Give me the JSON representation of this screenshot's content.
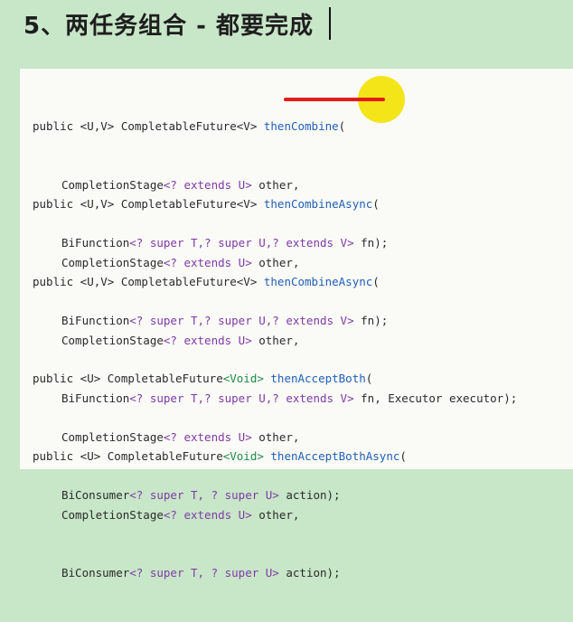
{
  "slide": {
    "title": "5、两任务组合 - 都要完成"
  },
  "blocks": [
    {
      "signature_prefix": "public <U,V> CompletableFuture<V> ",
      "method": "thenCombine",
      "signature_suffix": "(",
      "line2_prefix": "CompletionStage",
      "line2_generic": "<? extends U>",
      "line2_suffix": " other,",
      "line3_prefix": "BiFunction",
      "line3_generic": "<? super T,? super U,? extends V>",
      "line3_suffix": " fn);"
    },
    {
      "signature_prefix": "public <U,V> CompletableFuture<V> ",
      "method": "thenCombineAsync",
      "signature_suffix": "(",
      "line2_prefix": "CompletionStage",
      "line2_generic": "<? extends U>",
      "line2_suffix": " other,",
      "line3_prefix": "BiFunction",
      "line3_generic": "<? super T,? super U,? extends V>",
      "line3_suffix": " fn);"
    },
    {
      "signature_prefix": "public <U,V> CompletableFuture<V> ",
      "method": "thenCombineAsync",
      "signature_suffix": "(",
      "line2_prefix": "CompletionStage",
      "line2_generic": "<? extends U>",
      "line2_suffix": " other,",
      "line3_prefix": "BiFunction",
      "line3_generic": "<? super T,? super U,? extends V>",
      "line3_suffix": " fn, Executor executor);"
    },
    {
      "signature_prefix": "public <U> CompletableFuture",
      "generic_void": "<Void>",
      "method": " thenAcceptBoth",
      "signature_suffix": "(",
      "line2_prefix": "CompletionStage",
      "line2_generic": "<? extends U>",
      "line2_suffix": " other,",
      "line3_prefix": "BiConsumer",
      "line3_generic": "<? super T, ? super U>",
      "line3_suffix": " action);"
    },
    {
      "signature_prefix": "public <U> CompletableFuture",
      "generic_void": "<Void>",
      "method": " thenAcceptBothAsync",
      "signature_suffix": "(",
      "line2_prefix": "CompletionStage",
      "line2_generic": "<? extends U>",
      "line2_suffix": " other,",
      "line3_prefix": "BiConsumer",
      "line3_generic": "<? super T, ? super U>",
      "line3_suffix": " action);"
    }
  ],
  "colors": {
    "background": "#c8e6c8",
    "panel": "#fafaf6",
    "method": "#2060b8",
    "keyword": "#7f3aa8",
    "highlight_dot": "#f2e40c",
    "underline": "#e41b1b"
  }
}
